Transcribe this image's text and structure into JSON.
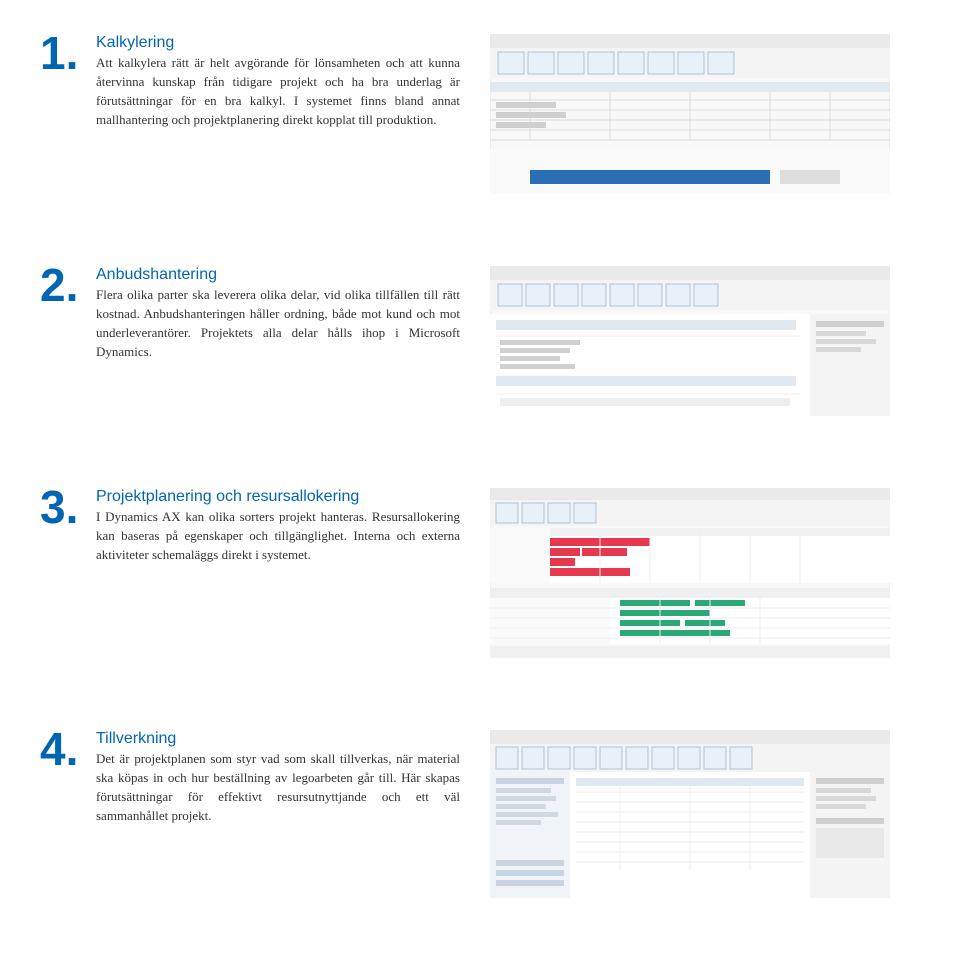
{
  "sections": [
    {
      "num": "1.",
      "heading": "Kalkylering",
      "body": "Att kalkylera rätt är helt avgörande för lönsamheten och att kunna återvinna kunskap från tidigare projekt och ha bra underlag är förutsättningar för en bra kalkyl. I systemet finns bland annat mallhantering och projektplanering direkt kopplat till produktion."
    },
    {
      "num": "2.",
      "heading": "Anbudshantering",
      "body": "Flera olika parter ska leverera olika delar, vid olika tillfällen till rätt kostnad. Anbudshanteringen håller ordning, både mot kund och mot underleverantörer. Projektets alla delar hålls ihop i Microsoft Dynamics."
    },
    {
      "num": "3.",
      "heading": "Projektplanering och resursallokering",
      "body": "I Dynamics AX kan olika sorters projekt hanteras. Resursallokering kan baseras på egenskaper och tillgänglighet. Interna och externa aktiviteter schemaläggs direkt i systemet."
    },
    {
      "num": "4.",
      "heading": "Tillverkning",
      "body": "Det är projektplanen som styr vad som skall tillverkas, när material ska köpas in och hur beställning av legoarbeten går till. Här skapas förutsättningar för effektivt resursutnyttjande och ett väl sammanhållet projekt."
    }
  ]
}
